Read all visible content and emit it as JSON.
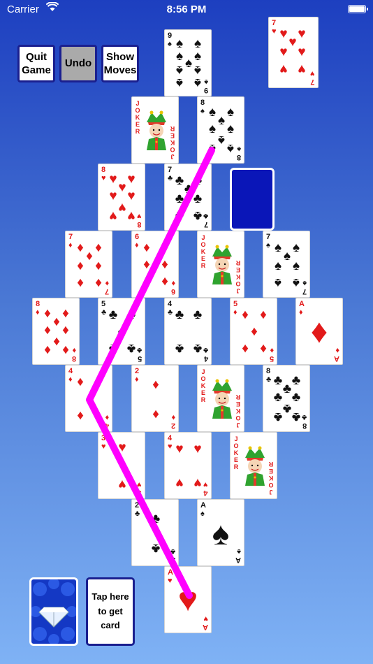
{
  "status": {
    "carrier": "Carrier",
    "time": "8:56 PM"
  },
  "buttons": {
    "quit": "Quit Game",
    "undo": "Undo",
    "show_moves": "Show Moves"
  },
  "top_card": {
    "rank": "7",
    "suit": "hearts"
  },
  "tap_card_label": "Tap here to get card",
  "joker_word": "JOKER",
  "path_color": "#ff00ff",
  "cards": [
    {
      "id": "r1c1",
      "rank": "9",
      "suit": "spades"
    },
    {
      "id": "r2c1",
      "rank": "JOKER",
      "suit": "joker"
    },
    {
      "id": "r2c2",
      "rank": "8",
      "suit": "spades"
    },
    {
      "id": "r3c1",
      "rank": "8",
      "suit": "hearts"
    },
    {
      "id": "r3c2",
      "rank": "7",
      "suit": "clubs"
    },
    {
      "id": "r3c3",
      "rank": "",
      "suit": "back"
    },
    {
      "id": "r4c1",
      "rank": "7",
      "suit": "diamonds"
    },
    {
      "id": "r4c2",
      "rank": "6",
      "suit": "diamonds"
    },
    {
      "id": "r4c3",
      "rank": "JOKER",
      "suit": "joker"
    },
    {
      "id": "r4c4",
      "rank": "7",
      "suit": "spades"
    },
    {
      "id": "r5c1",
      "rank": "8",
      "suit": "diamonds"
    },
    {
      "id": "r5c2",
      "rank": "5",
      "suit": "clubs"
    },
    {
      "id": "r5c3",
      "rank": "4",
      "suit": "clubs"
    },
    {
      "id": "r5c4",
      "rank": "5",
      "suit": "diamonds"
    },
    {
      "id": "r5c5",
      "rank": "A",
      "suit": "diamonds"
    },
    {
      "id": "r6c1",
      "rank": "4",
      "suit": "diamonds"
    },
    {
      "id": "r6c2",
      "rank": "2",
      "suit": "diamonds"
    },
    {
      "id": "r6c3",
      "rank": "JOKER",
      "suit": "joker"
    },
    {
      "id": "r6c4",
      "rank": "8",
      "suit": "clubs"
    },
    {
      "id": "r7c1",
      "rank": "3",
      "suit": "hearts"
    },
    {
      "id": "r7c2",
      "rank": "4",
      "suit": "hearts"
    },
    {
      "id": "r7c3",
      "rank": "JOKER",
      "suit": "joker"
    },
    {
      "id": "r8c1",
      "rank": "2",
      "suit": "clubs"
    },
    {
      "id": "r8c2",
      "rank": "A",
      "suit": "spades"
    },
    {
      "id": "r9c1",
      "rank": "A",
      "suit": "hearts"
    }
  ]
}
